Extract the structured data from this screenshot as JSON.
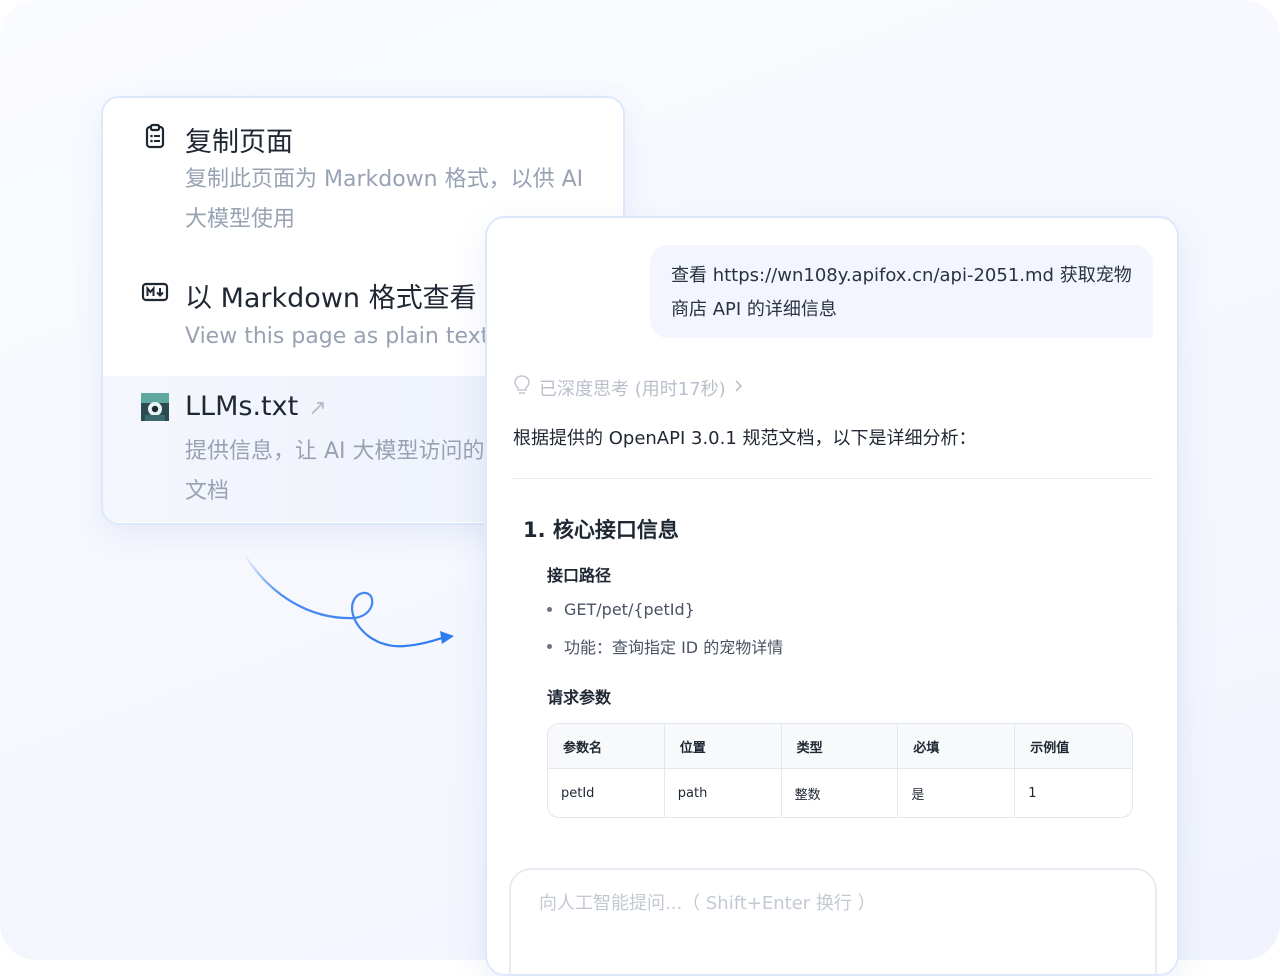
{
  "menu": {
    "items": [
      {
        "title": "复制页面",
        "desc": "复制此页面为 Markdown 格式，以供 AI 大模型使用",
        "icon": "clipboard-icon"
      },
      {
        "title": "以 Markdown 格式查看",
        "desc": "View this page as plain text",
        "icon": "markdown-icon"
      },
      {
        "title": "LLMs.txt",
        "desc": "提供信息，让 AI 大模型访问的所有 API 文档",
        "icon": "llms-logo-icon",
        "trailing_icon": "external-arrow-icon"
      }
    ]
  },
  "chat": {
    "user_message": "查看 https://wn108y.apifox.cn/api-2051.md 获取宠物商店 API 的详细信息",
    "thinking_label": "已深度思考 (用时17秒)",
    "intro": "根据提供的 OpenAPI 3.0.1 规范文档，以下是详细分析：",
    "section_title": "1. 核心接口信息",
    "subsection_path": "接口路径",
    "bullets": [
      "GET/pet/{petId}",
      "功能：查询指定 ID 的宠物详情"
    ],
    "subsection_params": "请求参数",
    "table": {
      "headers": [
        "参数名",
        "位置",
        "类型",
        "必填",
        "示例值"
      ],
      "rows": [
        [
          "petId",
          "path",
          "整数",
          "是",
          "1"
        ]
      ]
    },
    "input_placeholder": "向人工智能提问...（ Shift+Enter 换行 ）"
  },
  "colors": {
    "accent": "#2f7bf0",
    "border": "#dde8fb",
    "muted": "#98a2b3"
  }
}
